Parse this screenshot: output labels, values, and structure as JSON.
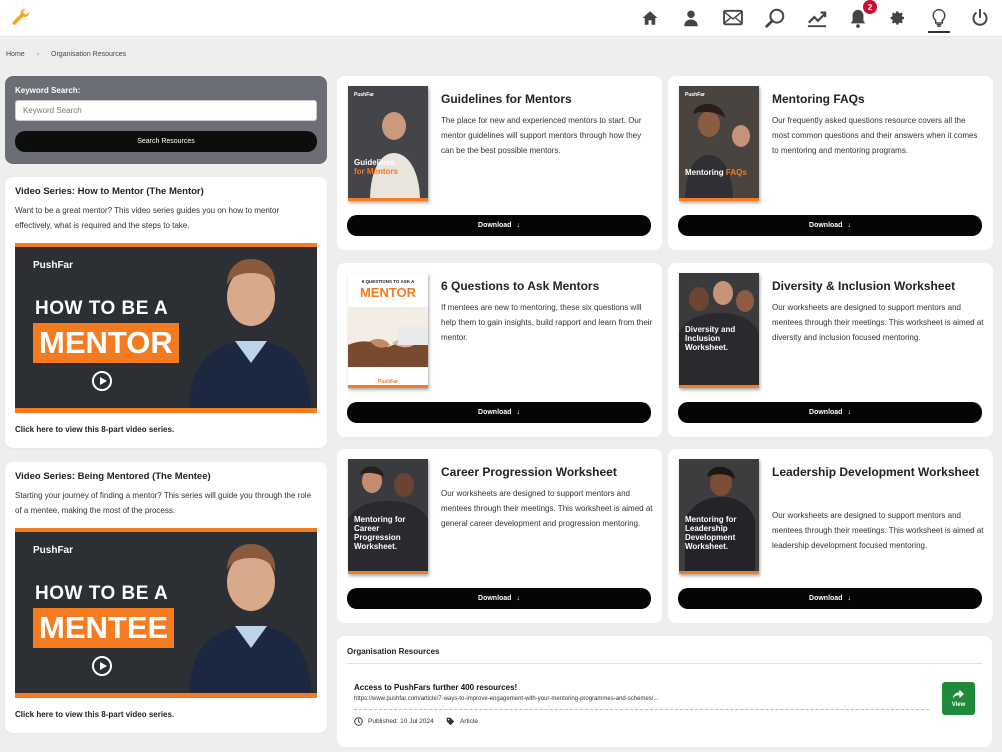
{
  "topbar": {
    "notification_count": "2",
    "icons": [
      "wrench-icon",
      "home-icon",
      "user-icon",
      "mail-icon",
      "search-icon",
      "chart-icon",
      "bell-icon",
      "gear-icon",
      "lightbulb-icon",
      "power-icon"
    ]
  },
  "breadcrumb": {
    "home": "Home",
    "separator": "›",
    "current": "Organisation Resources"
  },
  "search": {
    "label": "Keyword Search:",
    "placeholder": "Keyword Search",
    "button": "Search Resources"
  },
  "videos": [
    {
      "title": "Video Series: How to Mentor (The Mentor)",
      "description": "Want to be a great mentor? This video series guides you on how to mentor effectively, what is required and the steps to take.",
      "thumb_brand": "PushFar",
      "thumb_heading": "HOW TO BE A",
      "thumb_word": "MENTOR",
      "link": "Click here to view this 8-part video series."
    },
    {
      "title": "Video Series: Being Mentored (The Mentee)",
      "description": "Starting your journey of finding a mentor? This series will guide you through the role of a mentee, making the most of the process.",
      "thumb_brand": "PushFar",
      "thumb_heading": "HOW TO BE A",
      "thumb_word": "MENTEE",
      "link": "Click here to view this 8-part video series."
    }
  ],
  "resources": [
    {
      "title": "Guidelines for Mentors",
      "description": "The place for new and experienced mentors to start. Our mentor guidelines will support mentors through how they can be the best possible mentors.",
      "cover_text": "Guidelines",
      "cover_accent": "for Mentors",
      "download": "Download"
    },
    {
      "title": "Mentoring FAQs",
      "description": "Our frequently asked questions resource covers all the most common questions and their answers when it comes to mentoring and mentoring programs.",
      "cover_text": "Mentoring",
      "cover_accent": "FAQs",
      "download": "Download"
    },
    {
      "title": "6 Questions to Ask Mentors",
      "description": "If mentees are new to mentoring, these six questions will help them to gain insights, build rapport and learn from their mentor.",
      "cover_text": "6 QUESTIONS TO ASK A",
      "cover_accent": "MENTOR",
      "download": "Download"
    },
    {
      "title": "Diversity & Inclusion Worksheet",
      "description": "Our worksheets are designed to support mentors and mentees through their meetings. This worksheet is aimed at diversity and inclusion focused mentoring.",
      "cover_text": "Diversity and Inclusion Worksheet.",
      "download": "Download"
    },
    {
      "title": "Career Progression Worksheet",
      "description": "Our worksheets are designed to support mentors and mentees through their meetings. This worksheet is aimed at general career development and progression mentoring.",
      "cover_text": "Mentoring for Career Progression Worksheet.",
      "download": "Download"
    },
    {
      "title": "Leadership Development Worksheet",
      "description": "Our worksheets are designed to support mentors and mentees through their meetings. This worksheet is aimed at leadership development focused mentoring.",
      "cover_text": "Mentoring for Leadership Development Worksheet.",
      "download": "Download"
    }
  ],
  "cover_brand": "PushFar",
  "org_resources": {
    "title": "Organisation Resources",
    "item_title": "Access to PushFars further 400 resources!",
    "item_url": "https://www.pushfar.com/article/7-ways-to-improve-engagement-with-your-mentoring-programmes-and-schemes/...",
    "published": "Published: 10 Jul 2024",
    "tag": "Article",
    "view": "View"
  },
  "colors": {
    "accent": "#f47b20",
    "dark": "#050505",
    "panel": "#6b6f75",
    "view_green": "#1f8a3b",
    "badge": "#c8102e"
  }
}
